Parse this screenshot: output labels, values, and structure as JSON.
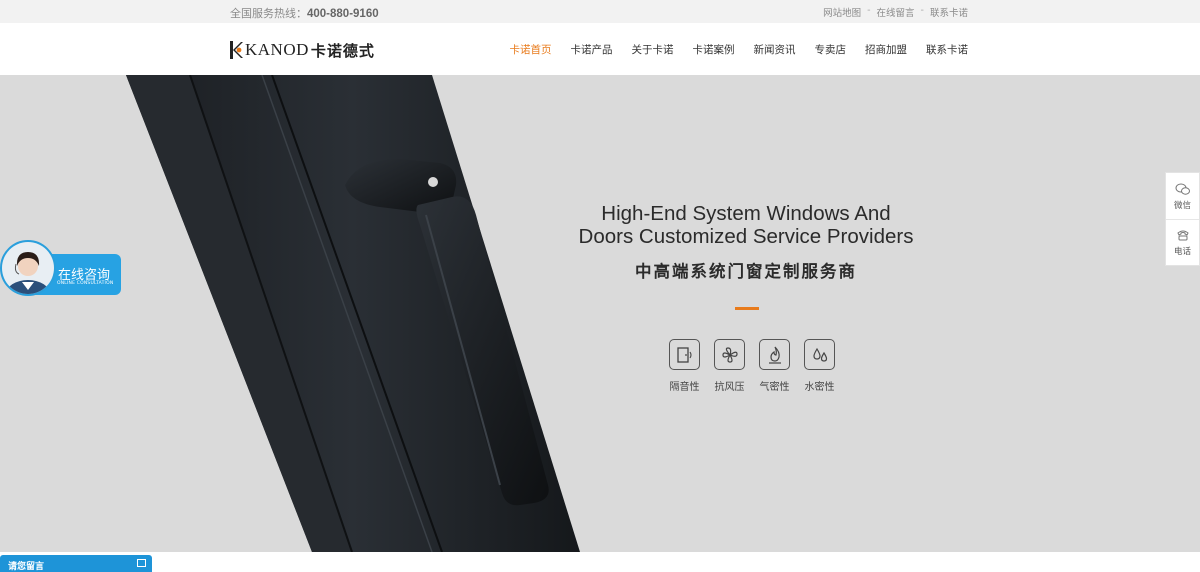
{
  "topbar": {
    "hotline_label": "全国服务热线：",
    "hotline_number": "400-880-9160",
    "links": [
      "网站地图",
      "在线留言",
      "联系卡诺"
    ],
    "separator": "-"
  },
  "header": {
    "logo_en": "KANOD",
    "logo_cn": "卡诺德式",
    "nav": [
      {
        "label": "卡诺首页",
        "active": true
      },
      {
        "label": "卡诺产品",
        "active": false
      },
      {
        "label": "关于卡诺",
        "active": false
      },
      {
        "label": "卡诺案例",
        "active": false
      },
      {
        "label": "新闻资讯",
        "active": false
      },
      {
        "label": "专卖店",
        "active": false
      },
      {
        "label": "招商加盟",
        "active": false
      },
      {
        "label": "联系卡诺",
        "active": false
      }
    ]
  },
  "hero": {
    "headline_line1": "High-End System Windows And",
    "headline_line2": "Doors Customized Service Providers",
    "subtitle": "中高端系统门窗定制服务商",
    "features": [
      {
        "label": "隔音性",
        "icon": "door-sound-icon"
      },
      {
        "label": "抗风压",
        "icon": "wind-icon"
      },
      {
        "label": "气密性",
        "icon": "flame-seal-icon"
      },
      {
        "label": "水密性",
        "icon": "water-drops-icon"
      }
    ]
  },
  "right_float": {
    "wechat_label": "微信",
    "phone_label": "电话"
  },
  "consult": {
    "title": "在线咨询",
    "subtitle": "ONLINE CONSULTATION"
  },
  "message_bar": {
    "label": "请您留言"
  },
  "colors": {
    "accent": "#e87b1c",
    "consult_blue": "#27a2e3",
    "hero_bg": "#dadada"
  }
}
